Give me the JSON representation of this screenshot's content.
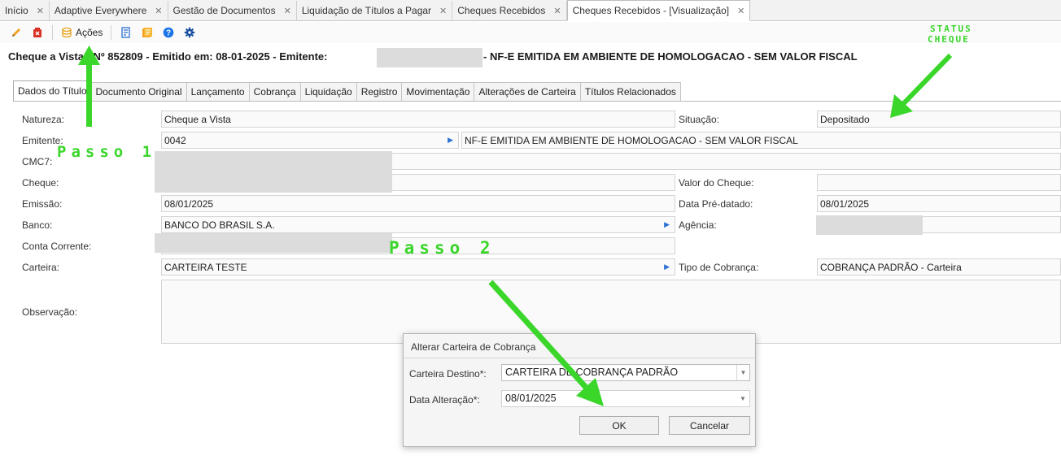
{
  "tabs": [
    {
      "label": "Início"
    },
    {
      "label": "Adaptive Everywhere"
    },
    {
      "label": "Gestão de Documentos"
    },
    {
      "label": "Liquidação de Títulos a Pagar"
    },
    {
      "label": "Cheques Recebidos"
    },
    {
      "label": "Cheques Recebidos - [Visualização]"
    }
  ],
  "toolbar": {
    "acoes_label": "Ações"
  },
  "header": {
    "part1": "Cheque a Vista - Nº 852809 - Emitido em: 08-01-2025 - Emitente:",
    "part2": "- NF-E EMITIDA EM AMBIENTE DE HOMOLOGACAO - SEM VALOR FISCAL"
  },
  "subtabs": [
    {
      "label": "Dados do Título"
    },
    {
      "label": "Documento Original"
    },
    {
      "label": "Lançamento"
    },
    {
      "label": "Cobrança"
    },
    {
      "label": "Liquidação"
    },
    {
      "label": "Registro"
    },
    {
      "label": "Movimentação"
    },
    {
      "label": "Alterações de Carteira"
    },
    {
      "label": "Títulos Relacionados"
    }
  ],
  "form": {
    "natureza_label": "Natureza:",
    "natureza_value": "Cheque a Vista",
    "situacao_label": "Situação:",
    "situacao_value": "Depositado",
    "emitente_label": "Emitente:",
    "emitente_code": "0042",
    "emitente_name": "NF-E EMITIDA EM AMBIENTE DE HOMOLOGACAO - SEM VALOR FISCAL",
    "cmc7_label": "CMC7:",
    "cheque_label": "Cheque:",
    "valor_label": "Valor do Cheque:",
    "emissao_label": "Emissão:",
    "emissao_value": "08/01/2025",
    "predatado_label": "Data Pré-datado:",
    "predatado_value": "08/01/2025",
    "banco_label": "Banco:",
    "banco_value": "BANCO DO BRASIL S.A.",
    "agencia_label": "Agência:",
    "conta_label": "Conta Corrente:",
    "carteira_label": "Carteira:",
    "carteira_value": "CARTEIRA TESTE",
    "tipo_cobranca_label": "Tipo de Cobrança:",
    "tipo_cobranca_value": "COBRANÇA PADRÃO - Carteira",
    "observacao_label": "Observação:"
  },
  "dialog": {
    "title": "Alterar Carteira de Cobrança",
    "carteira_destino_label": "Carteira Destino*:",
    "carteira_destino_value": "CARTEIRA DE COBRANÇA PADRÃO",
    "data_alteracao_label": "Data Alteração*:",
    "data_alteracao_value": "08/01/2025",
    "ok_label": "OK",
    "cancel_label": "Cancelar"
  },
  "annotations": {
    "passo1": "Passo 1",
    "passo2": "Passo 2",
    "status_line1": "STATUS",
    "status_line2": "CHEQUE"
  },
  "colors": {
    "annotation_green": "#3ad62a",
    "link_blue": "#2b6fd1",
    "delete_red": "#d93025",
    "edit_orange": "#f0a020"
  }
}
